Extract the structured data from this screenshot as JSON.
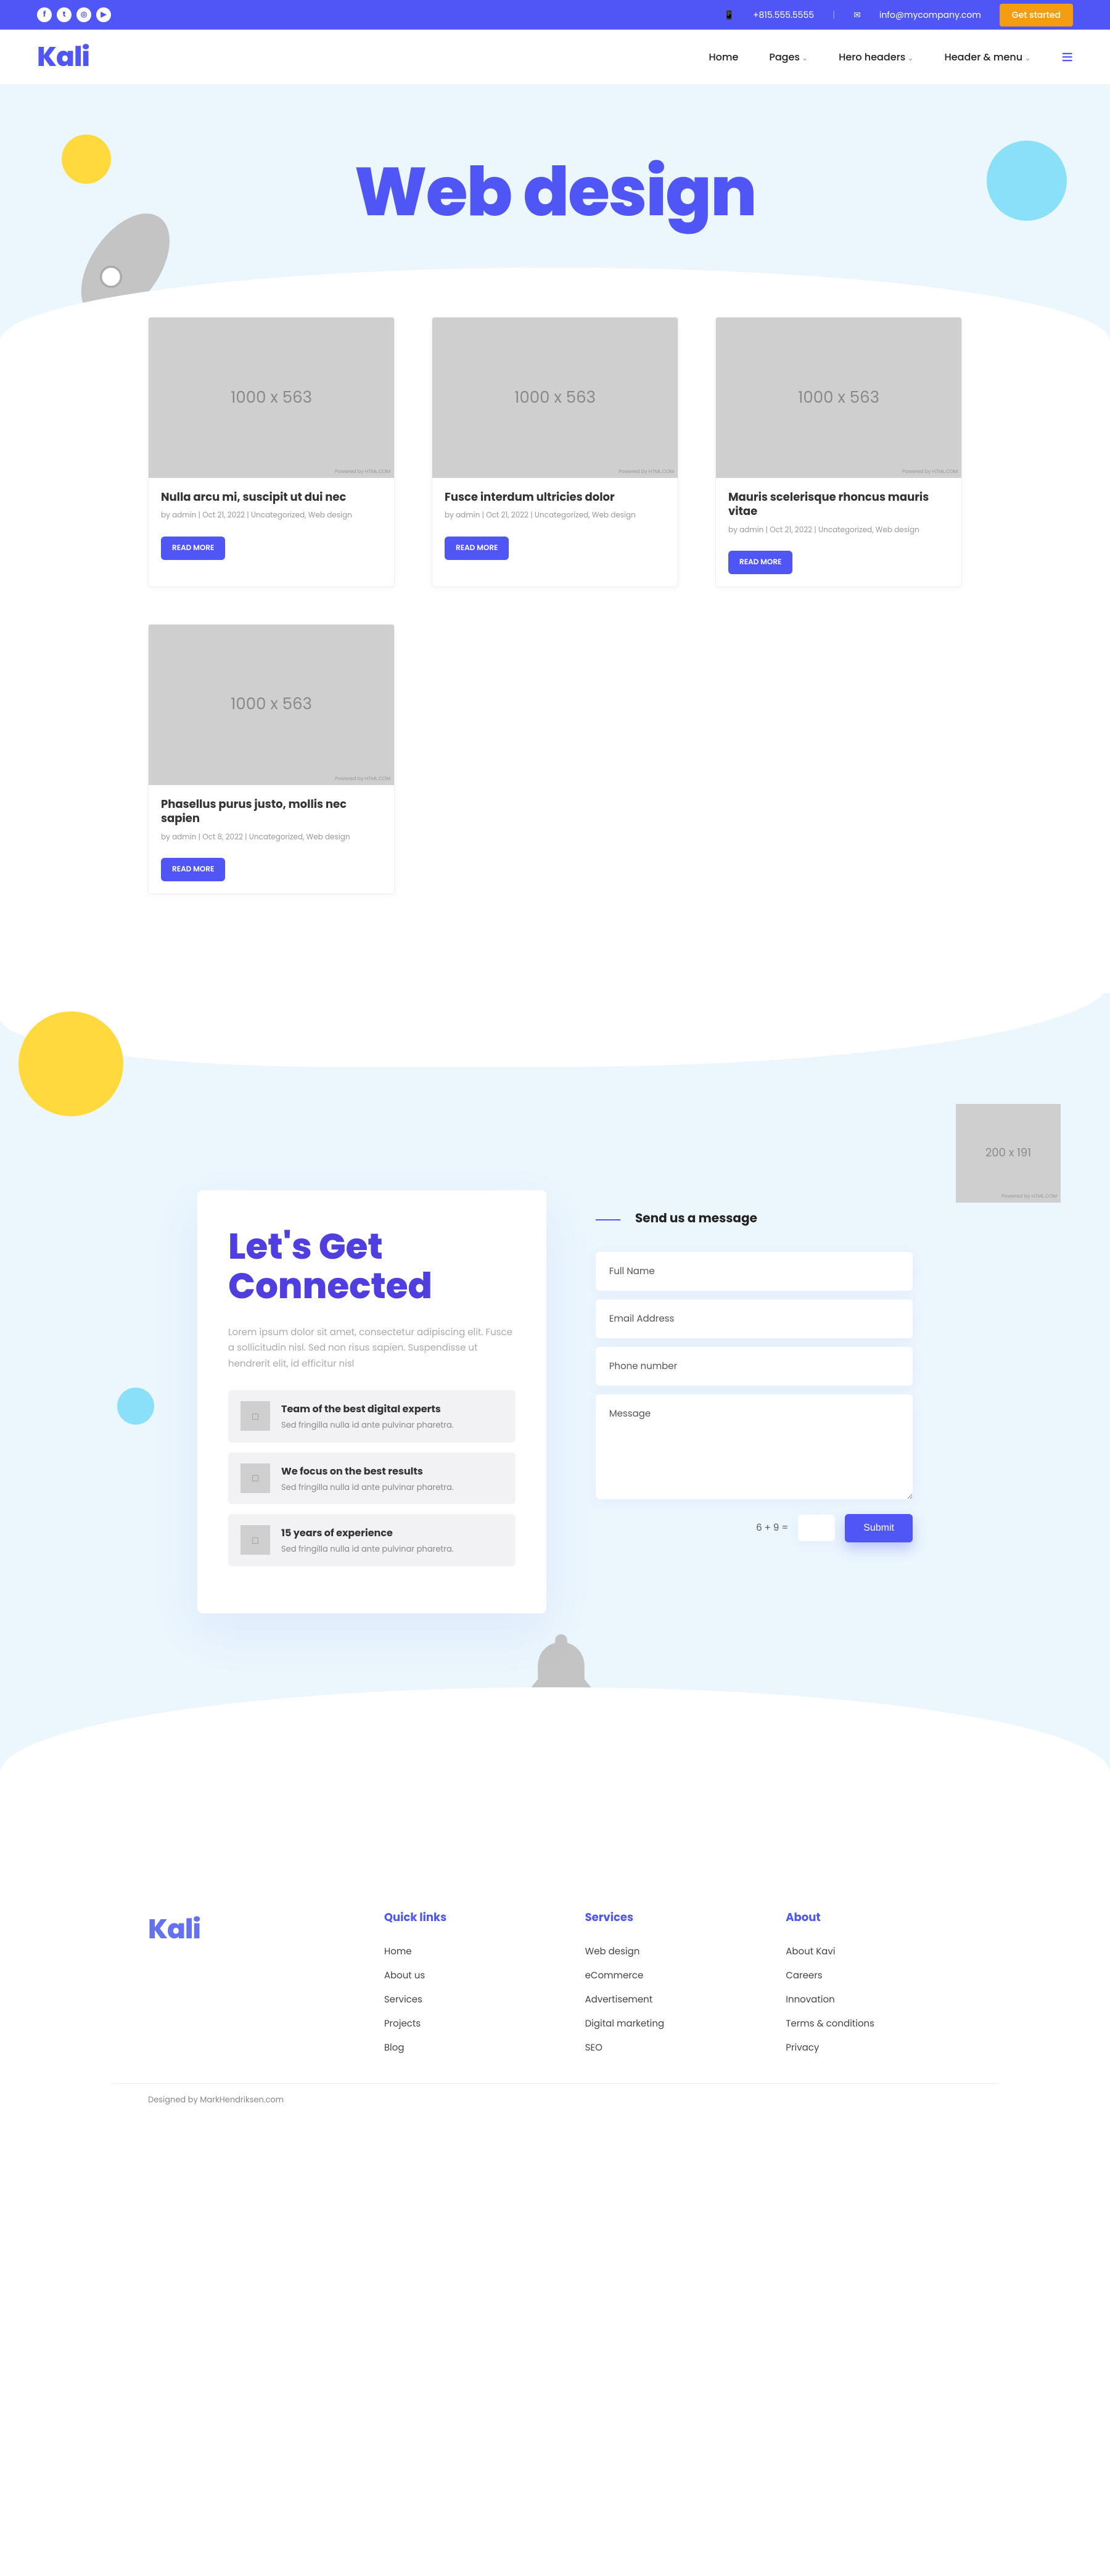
{
  "topbar": {
    "phone": "+815.555.5555",
    "email": "info@mycompany.com",
    "cta": "Get started"
  },
  "nav": {
    "logo": "Kali",
    "items": [
      {
        "label": "Home",
        "dropdown": false
      },
      {
        "label": "Pages",
        "dropdown": true
      },
      {
        "label": "Hero headers",
        "dropdown": true
      },
      {
        "label": "Header & menu",
        "dropdown": true
      }
    ]
  },
  "hero": {
    "title": "Web design"
  },
  "placeholder_label": "1000 x 563",
  "posts": [
    {
      "title": "Nulla arcu mi, suscipit ut dui nec",
      "meta": "by admin | Oct 21, 2022 | Uncategorized, Web design",
      "cta": "READ MORE"
    },
    {
      "title": "Fusce interdum ultricies dolor",
      "meta": "by admin | Oct 21, 2022 | Uncategorized, Web design",
      "cta": "READ MORE"
    },
    {
      "title": "Mauris scelerisque rhoncus mauris vitae",
      "meta": "by admin | Oct 21, 2022 | Uncategorized, Web design",
      "cta": "READ MORE"
    },
    {
      "title": "Phasellus purus justo, mollis nec sapien",
      "meta": "by admin | Oct 8, 2022 | Uncategorized, Web design",
      "cta": "READ MORE"
    }
  ],
  "contact": {
    "heading": "Let's Get Connected",
    "subheading": "Lorem ipsum dolor sit amet, consectetur adipiscing elit. Fusce a sollicitudin nisl. Sed non risus sapien. Suspendisse ut hendrerit elit, id efficitur nisl",
    "placeholder_small": "200 x 191",
    "features": [
      {
        "title": "Team of the best digital experts",
        "text": "Sed fringilla nulla id ante pulvinar pharetra."
      },
      {
        "title": "We focus on the best results",
        "text": "Sed fringilla nulla id ante pulvinar pharetra."
      },
      {
        "title": "15 years of experience",
        "text": "Sed fringilla nulla id ante pulvinar pharetra."
      }
    ],
    "form_title": "Send us a message",
    "fields": {
      "name": "Full Name",
      "email": "Email Address",
      "phone": "Phone number",
      "message": "Message"
    },
    "captcha": "6 + 9 =",
    "submit": "Submit"
  },
  "footer": {
    "logo": "Kali",
    "columns": [
      {
        "heading": "Quick links",
        "items": [
          "Home",
          "About us",
          "Services",
          "Projects",
          "Blog"
        ]
      },
      {
        "heading": "Services",
        "items": [
          "Web design",
          "eCommerce",
          "Advertisement",
          "Digital marketing",
          "SEO"
        ]
      },
      {
        "heading": "About",
        "items": [
          "About Kavi",
          "Careers",
          "Innovation",
          "Terms & conditions",
          "Privacy"
        ]
      }
    ],
    "copyright": "Designed by MarkHendriksen.com"
  }
}
